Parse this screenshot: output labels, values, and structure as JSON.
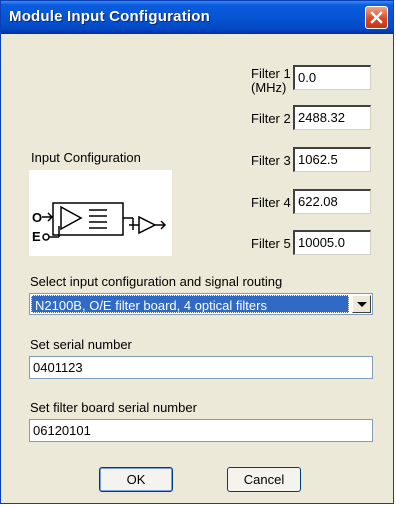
{
  "window": {
    "title": "Module Input Configuration",
    "close_icon": "close-icon"
  },
  "filters": [
    {
      "label": "Filter 1",
      "sublabel": "(MHz)",
      "value": "0.0"
    },
    {
      "label": "Filter 2",
      "value": "2488.32"
    },
    {
      "label": "Filter 3",
      "value": "1062.5"
    },
    {
      "label": "Filter 4",
      "value": "622.08"
    },
    {
      "label": "Filter 5",
      "value": "10005.0"
    }
  ],
  "input_config": {
    "label": "Input Configuration",
    "diagram_labels": [
      "O",
      "E"
    ]
  },
  "routing": {
    "label": "Select input configuration and signal routing",
    "selected": "N2100B, O/E filter board, 4 optical filters"
  },
  "serial": {
    "label": "Set serial number",
    "value": "0401123"
  },
  "filter_board_serial": {
    "label": "Set filter board serial number",
    "value": "06120101"
  },
  "buttons": {
    "ok": "OK",
    "cancel": "Cancel"
  },
  "colors": {
    "titlebar": "#0654d4",
    "dialog_bg": "#ece9d8",
    "selection": "#316ac5",
    "close": "#d84a25"
  }
}
